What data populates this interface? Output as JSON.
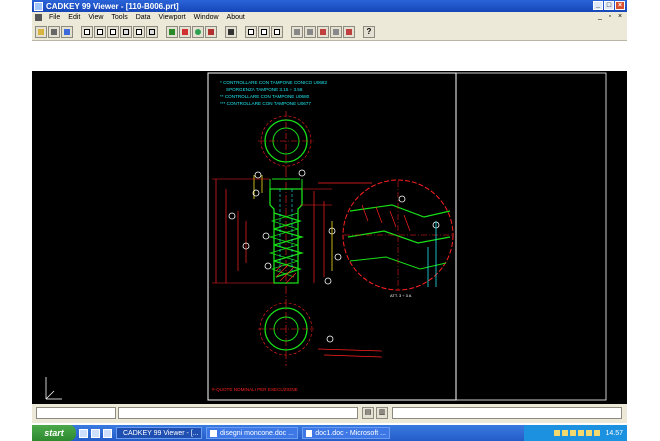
{
  "window": {
    "title": "CADKEY 99 Viewer - [110-B006.prt]"
  },
  "menu": {
    "items": [
      "File",
      "Edit",
      "View",
      "Tools",
      "Data",
      "Viewport",
      "Window",
      "About"
    ]
  },
  "toolbar": {
    "groups": [
      [
        "open-icon",
        "print-icon",
        "print-preview-icon"
      ],
      [
        "view-box-icon",
        "view-box-2-icon",
        "view-box-3-icon",
        "view-box-4-icon",
        "view-box-5-icon",
        "view-box-6-icon"
      ],
      [
        "pan-icon",
        "zoom-icon",
        "rotate-icon",
        "view-icon"
      ],
      [
        "layer-icon"
      ],
      [
        "window-1-icon",
        "window-2-icon",
        "window-3-icon"
      ],
      [
        "measure-icon",
        "measure-2-icon",
        "measure-3-icon",
        "measure-4-icon",
        "measure-5-icon"
      ],
      [
        "help-icon"
      ]
    ]
  },
  "drawing": {
    "notes": [
      "* CONTROLLARE CON TAMPONE CONICO U0682",
      "SPORGENZA TAMPONE 3.15 ÷ 3.58",
      "** CONTROLLARE CON TAMPONE U0680",
      "*** CONTROLLARE CON TAMPONE U0677"
    ],
    "bottom_note": "#-QUOTE NOMINALI PER ESECUZIONE",
    "annotation_right": "ATT. 3 ÷ 3 A"
  },
  "taskbar": {
    "start_label": "start",
    "tasks": [
      "CADKEY 99 Viewer - [...",
      "disegni moncone.doc ...",
      "doc1.doc - Microsoft ..."
    ],
    "clock": "14.57"
  },
  "colors": {
    "titlebar": "#1646b8",
    "drawing_bg": "#000000",
    "cad_red": "#ff2020",
    "cad_green": "#18e018",
    "cad_cyan": "#20e8f0",
    "cad_yellow": "#f0e020"
  }
}
